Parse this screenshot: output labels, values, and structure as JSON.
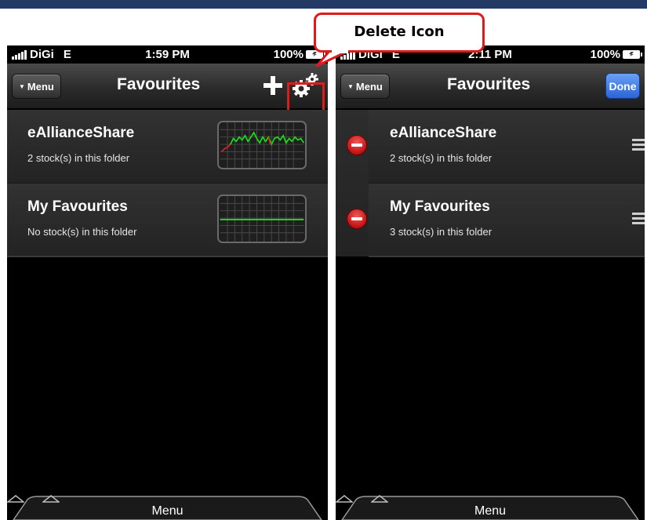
{
  "left_screen": {
    "status": {
      "carrier": "DiGi",
      "network": "E",
      "time": "1:59 PM",
      "battery": "100%"
    },
    "nav": {
      "menu_label": "Menu",
      "title": "Favourites"
    },
    "folders": [
      {
        "name": "eAllianceShare",
        "subtitle": "2 stock(s) in this folder"
      },
      {
        "name": "My Favourites",
        "subtitle": "No stock(s) in this folder"
      }
    ],
    "tabbar": {
      "label": "Menu"
    }
  },
  "right_screen": {
    "status": {
      "carrier": "DiGi",
      "network": "E",
      "time": "2:11 PM",
      "battery": "100%"
    },
    "nav": {
      "menu_label": "Menu",
      "title": "Favourites",
      "done_label": "Done"
    },
    "folders": [
      {
        "name": "eAllianceShare",
        "subtitle": "2 stock(s) in this folder"
      },
      {
        "name": "My Favourites",
        "subtitle": "3 stock(s) in this folder"
      }
    ],
    "tabbar": {
      "label": "Menu"
    }
  },
  "annotation": {
    "label": "Delete Icon",
    "color": "#e01a1a"
  },
  "colors": {
    "header_band": "#233a64",
    "done_button": "#2a64d8",
    "chart_line": "#19e019",
    "delete_red": "#c31212"
  },
  "icons": [
    "signal-bars-icon",
    "battery-icon",
    "menu-caret-icon",
    "plus-icon",
    "gears-icon",
    "delete-circle-icon",
    "reorder-icon",
    "up-arrow-icon"
  ]
}
